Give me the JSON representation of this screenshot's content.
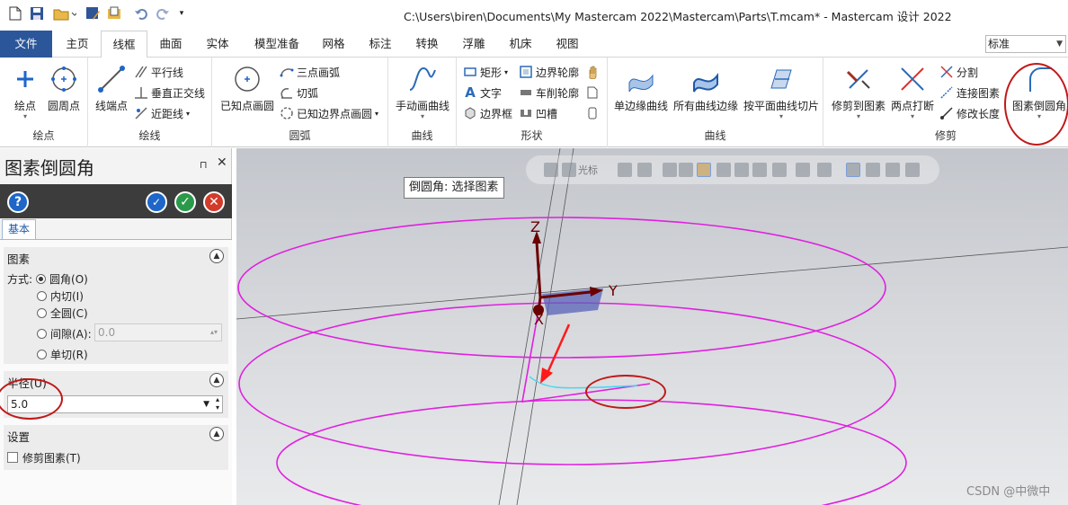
{
  "window_title": "C:\\Users\\biren\\Documents\\My Mastercam 2022\\Mastercam\\Parts\\T.mcam* - Mastercam 设计 2022",
  "tabs": [
    "文件",
    "主页",
    "线框",
    "曲面",
    "实体",
    "模型准备",
    "网格",
    "标注",
    "转换",
    "浮雕",
    "机床",
    "视图"
  ],
  "active_tab": "线框",
  "view_select": "标准",
  "ribbon": {
    "points": {
      "label": "绘点",
      "btn_point": "绘点",
      "btn_circle_point": "圆周点"
    },
    "lines": {
      "label": "绘线",
      "btn_endpoint": "线端点",
      "btn_parallel": "平行线",
      "btn_perp": "垂直正交线",
      "btn_closest": "近距线"
    },
    "arcs": {
      "label": "圆弧",
      "btn_known_point": "已知点画圆",
      "btn_three_point": "三点画弧",
      "btn_tangent": "切弧",
      "btn_known_edge": "已知边界点画圆"
    },
    "curves_spline": {
      "label": "曲线",
      "btn_manual": "手动画曲线"
    },
    "shapes": {
      "label": "形状",
      "btn_rect": "矩形",
      "btn_text": "文字",
      "btn_bbox": "边界框",
      "btn_boundary": "边界轮廓",
      "btn_turn_profile": "车削轮廓",
      "btn_groove": "凹槽"
    },
    "curves": {
      "label": "曲线",
      "btn_single_edge": "单边缘曲线",
      "btn_all_edges": "所有曲线边缘",
      "btn_slice": "按平面曲线切片"
    },
    "trim": {
      "label": "修剪",
      "btn_trim_to": "修剪到图素",
      "btn_break_two": "两点打断",
      "btn_divide": "分割",
      "btn_join": "连接图素",
      "btn_modify_length": "修改长度",
      "btn_fillet": "图素倒圆角"
    }
  },
  "panel": {
    "title": "图素倒圆角",
    "tab_basic": "基本",
    "sec_entities": "图素",
    "method_label": "方式:",
    "methods": [
      "圆角(O)",
      "内切(I)",
      "全圆(C)",
      "间隙(A):",
      "单切(R)"
    ],
    "method_selected": "圆角(O)",
    "gap_value": "0.0",
    "sec_radius": "半径(U)",
    "radius_value": "5.0",
    "sec_settings": "设置",
    "trim_label": "修剪图素(T)",
    "trim_checked": false
  },
  "viewport": {
    "prompt": "倒圆角: 选择图素",
    "cursor_label": "光标",
    "axis_z": "Z",
    "axis_y": "Y",
    "axis_x": "X",
    "watermark": "CSDN @中微中",
    "toolbar_icons": [
      "cube-icon",
      "lock-icon",
      "xyz-icon",
      "select-icon",
      "box-view-icon",
      "shade-icon",
      "wireframe-icon",
      "zoom-icon",
      "rotate-icon"
    ]
  },
  "colors": {
    "file_tab": "#2b579a",
    "curve": "#e020e0",
    "axis": "#6b0000",
    "highlight": "#40d8f0",
    "annotation": "#c01818",
    "plane": "#5a63b8"
  }
}
